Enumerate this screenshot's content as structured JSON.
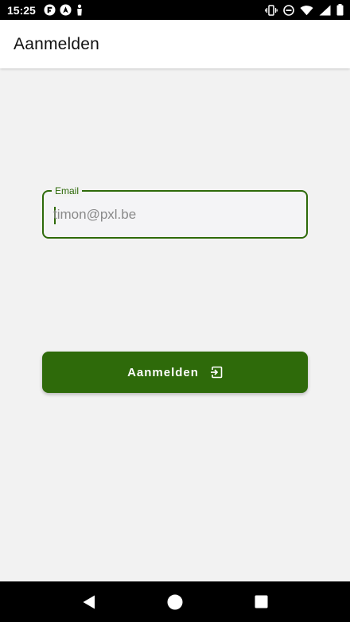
{
  "status_bar": {
    "time": "15:25",
    "left_icons": [
      "flipboard-icon",
      "navigation-app-icon",
      "accessibility-icon"
    ],
    "right_icons": [
      "vibrate-icon",
      "do-not-disturb-icon",
      "wifi-icon",
      "signal-icon",
      "battery-icon"
    ]
  },
  "app_bar": {
    "title": "Aanmelden"
  },
  "form": {
    "email": {
      "label": "Email",
      "placeholder": "timon@pxl.be",
      "value": ""
    },
    "submit": {
      "label": "Aanmelden",
      "icon": "login-icon"
    }
  },
  "nav_bar": {
    "buttons": [
      "back-icon",
      "home-icon",
      "recents-icon"
    ]
  },
  "colors": {
    "primary": "#2e6a0a",
    "background": "#f2f2f2",
    "app_bar": "#ffffff",
    "system_bars": "#000000"
  }
}
